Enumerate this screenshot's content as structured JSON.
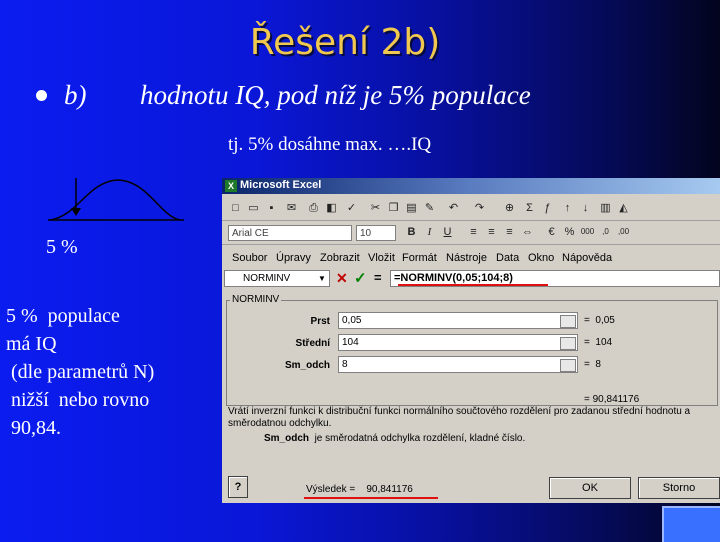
{
  "slide": {
    "title": "Řešení 2b)",
    "bullet_label": "b)",
    "bullet_text": "hodnotu IQ, pod níž je  5% populace",
    "subline": "tj. 5% dosáhne max.  ….IQ",
    "percent_label": "5 %",
    "description_lines": [
      "5 %  populace",
      "má IQ",
      " (dle parametrů N)",
      " nižší  nebo rovno",
      " 90,84."
    ]
  },
  "excel": {
    "window_title": "Microsoft Excel",
    "logo_letter": "X",
    "font_name": "Arial CE",
    "font_size": "10",
    "menu": [
      "Soubor",
      "Úpravy",
      "Zobrazit",
      "Vložit",
      "Formát",
      "Nástroje",
      "Data",
      "Okno",
      "Nápověda"
    ],
    "name_box": "NORMINV",
    "cancel_symbol": "✕",
    "enter_symbol": "✓",
    "fx_symbol": "=",
    "formula": "=NORMINV(0,05;104;8)",
    "dialog": {
      "function_name": "NORMINV",
      "args": [
        {
          "label": "Prst",
          "value": "0,05",
          "result": "0,05"
        },
        {
          "label": "Střední",
          "value": "104",
          "result": "104"
        },
        {
          "label": "Sm_odch",
          "value": "8",
          "result": "8"
        }
      ],
      "eq_sign": "=",
      "total_result": "= 90,841176",
      "description": "Vrátí inverzní funkci k distribuční funkci normálního součtového rozdělení pro zadanou střední hodnotu a směrodatnou odchylku.",
      "param_name": "Sm_odch",
      "param_desc": "je směrodatná odchylka rozdělení, kladné číslo.",
      "help_symbol": "?",
      "result_label": "Výsledek =",
      "result_value": "90,841176",
      "ok_label": "OK",
      "cancel_label": "Storno"
    }
  },
  "colors": {
    "title": "#f0c850",
    "underline": "#e01010",
    "background": "#0a17d8"
  }
}
